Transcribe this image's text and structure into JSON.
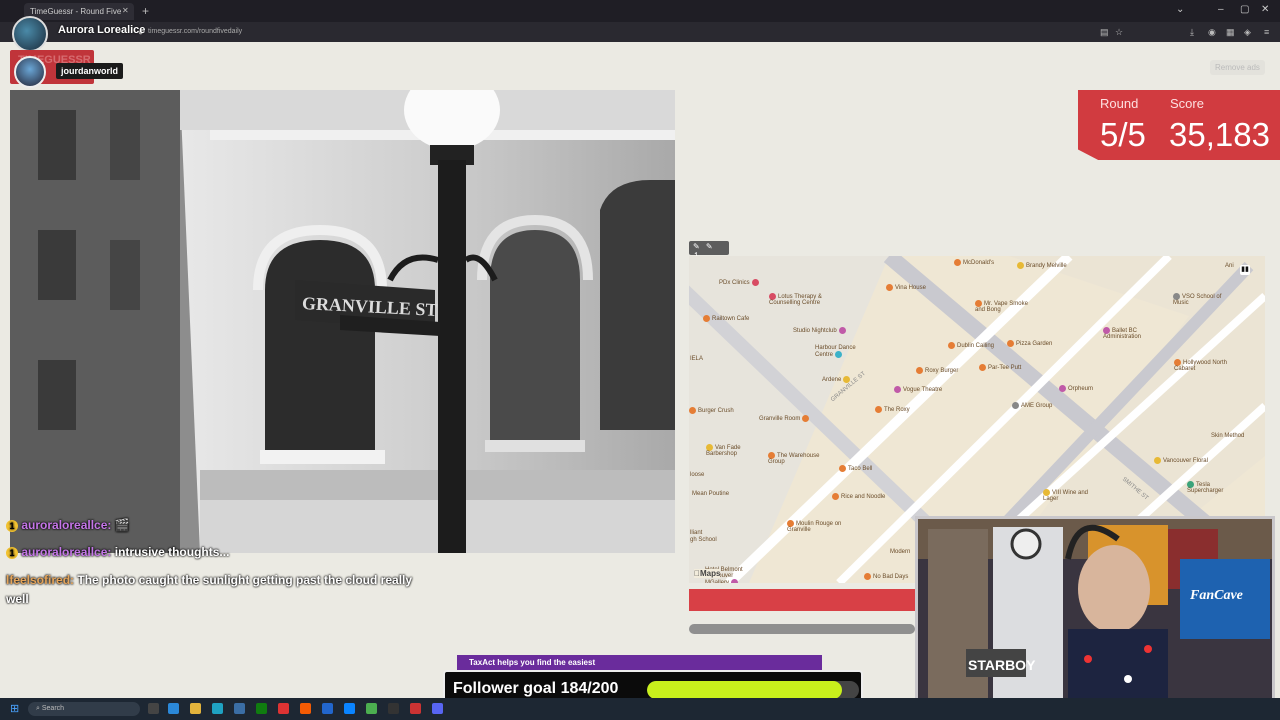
{
  "browser": {
    "tab_title": "TimeGuessr - Round Five",
    "url": "timeguessr.com/roundfivedaily",
    "streamer_name": "Aurora Lorealice"
  },
  "header": {
    "logo_text": "TIMEGUESSR",
    "player_tag": "jourdanworld",
    "remove_ads": "Remove ads"
  },
  "score": {
    "round_label": "Round",
    "score_label": "Score",
    "round_value": "5/5",
    "score_value": "35,183"
  },
  "photo": {
    "street_sign": "GRANVILLE ST"
  },
  "map": {
    "attribution": "Maps",
    "tools": "✎ ✎ ↿",
    "pois": [
      {
        "label": "McDonald's",
        "color": "o"
      },
      {
        "label": "Brandy Melville",
        "color": "y"
      },
      {
        "label": "PDx Clinics",
        "color": "r"
      },
      {
        "label": "Lotus Therapy & Counselling Centre",
        "color": "r"
      },
      {
        "label": "Vina House",
        "color": "o"
      },
      {
        "label": "Mr. Vape Smoke and Bong",
        "color": "o"
      },
      {
        "label": "VSO School of Music",
        "color": "g"
      },
      {
        "label": "Railtown Cafe",
        "color": "o"
      },
      {
        "label": "Studio Nightclub",
        "color": "p"
      },
      {
        "label": "Ballet BC Administration",
        "color": "p"
      },
      {
        "label": "Harbour Dance Centre",
        "color": "t"
      },
      {
        "label": "Dublin Calling",
        "color": "o"
      },
      {
        "label": "Pizza Garden",
        "color": "o"
      },
      {
        "label": "Hollywood North Cabaret",
        "color": "o"
      },
      {
        "label": "Roxy Burger",
        "color": "o"
      },
      {
        "label": "Par-Tee Putt",
        "color": "o"
      },
      {
        "label": "Ardene",
        "color": "y"
      },
      {
        "label": "Vogue Theatre",
        "color": "p"
      },
      {
        "label": "Orpheum",
        "color": "p"
      },
      {
        "label": "Burger Crush",
        "color": "o"
      },
      {
        "label": "The Roxy",
        "color": "o"
      },
      {
        "label": "AME Group",
        "color": "g"
      },
      {
        "label": "Granville Room",
        "color": "o"
      },
      {
        "label": "Skin Method",
        "color": "p"
      },
      {
        "label": "Van Fade Barbershop",
        "color": "y"
      },
      {
        "label": "The Warehouse Group",
        "color": "o"
      },
      {
        "label": "Taco Bell",
        "color": "o"
      },
      {
        "label": "Vancouver Floral",
        "color": "y"
      },
      {
        "label": "Tesla Supercharger",
        "color": "gr"
      },
      {
        "label": "Mean Poutine",
        "color": "o"
      },
      {
        "label": "Rice and Noodle",
        "color": "o"
      },
      {
        "label": "VIII Wine and Lager",
        "color": "y"
      },
      {
        "label": "Moulin Rouge on Granville",
        "color": "o"
      },
      {
        "label": "Modern",
        "color": "o"
      },
      {
        "label": "No Bad Days",
        "color": "o"
      },
      {
        "label": "Hotel Belmont Vancouver MGallery",
        "color": "p"
      }
    ],
    "street_labels": [
      "GRANVILLE ST",
      "SMITHE ST"
    ],
    "edge_labels": [
      "IELA",
      "loose",
      "lliant",
      "gh School",
      "Ani"
    ]
  },
  "chat": [
    {
      "badge": "1",
      "name": "auroraloreallce:",
      "text": "🎬"
    },
    {
      "badge": "1",
      "name": "auroraloreallce:",
      "text": "intrusive thoughts..."
    },
    {
      "badge": "",
      "name": "lfeelsofired:",
      "text": "The photo caught the sunlight getting past the cloud really well"
    }
  ],
  "follower_goal": {
    "label": "Follower goal 184/200",
    "current": 184,
    "target": 200
  },
  "ad_banner": "TaxAct helps you find the easiest",
  "webcam": {
    "sign_text": "STARBOY",
    "poster_text": "FanCave"
  },
  "taskbar": {
    "search_placeholder": "Search"
  }
}
